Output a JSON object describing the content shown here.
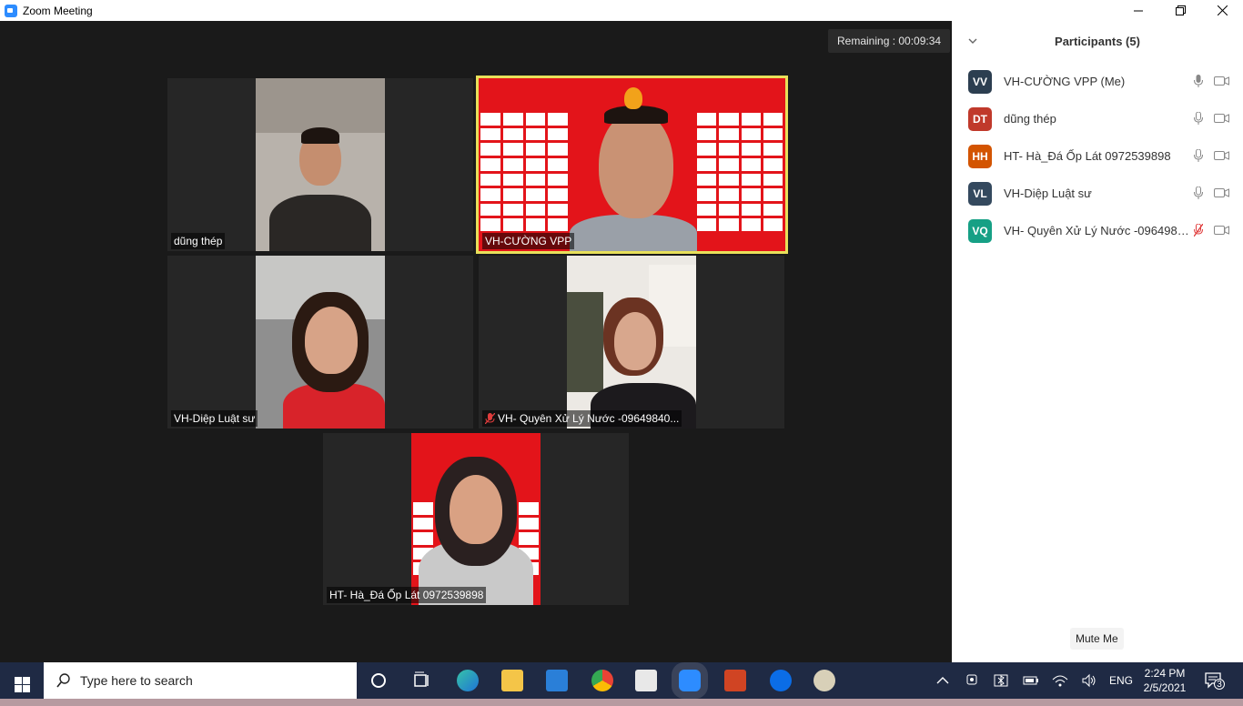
{
  "window": {
    "title": "Zoom Meeting",
    "minimize_icon": "minimize-icon",
    "maximize_icon": "restore-icon",
    "close_icon": "close-icon"
  },
  "meeting": {
    "remaining": "Remaining : 00:09:34",
    "tiles": [
      {
        "name": "dũng thép",
        "muted": false,
        "active": false
      },
      {
        "name": "VH-CƯỜNG VPP",
        "muted": false,
        "active": true
      },
      {
        "name": "VH-Diệp Luật sư",
        "muted": false,
        "active": false
      },
      {
        "name": "VH- Quyên Xử Lý Nước -09649840...",
        "muted": true,
        "active": false
      },
      {
        "name": "HT- Hà_Đá Ốp Lát 0972539898",
        "muted": false,
        "active": false
      }
    ]
  },
  "participants": {
    "header": "Participants (5)",
    "items": [
      {
        "initials": "VV",
        "name": "VH-CƯỜNG VPP (Me)",
        "color": "#2c3e50",
        "muted": false
      },
      {
        "initials": "DT",
        "name": "dũng thép",
        "color": "#c0392b",
        "muted": false
      },
      {
        "initials": "HH",
        "name": "HT- Hà_Đá Ốp Lát 0972539898",
        "color": "#d35400",
        "muted": false
      },
      {
        "initials": "VL",
        "name": "VH-Diệp Luật sư",
        "color": "#34495e",
        "muted": false
      },
      {
        "initials": "VQ",
        "name": "VH- Quyên Xử Lý Nước -0964984...",
        "color": "#16a085",
        "muted": true
      }
    ],
    "mute_me": "Mute Me"
  },
  "taskbar": {
    "search_placeholder": "Type here to search",
    "language": "ENG",
    "time": "2:24 PM",
    "date": "2/5/2021",
    "notification_count": "3"
  }
}
